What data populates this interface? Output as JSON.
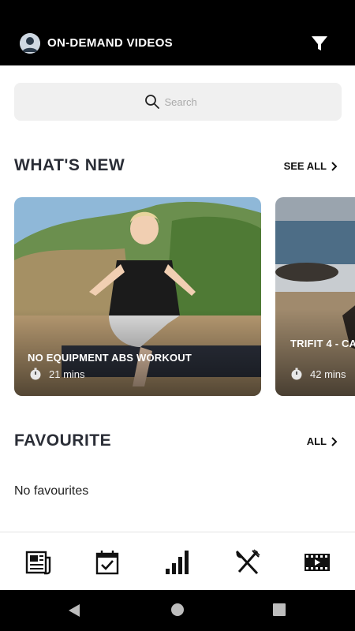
{
  "header": {
    "title": "ON-DEMAND VIDEOS",
    "avatar_icon": "user-avatar-icon",
    "filter_icon": "filter-icon"
  },
  "search": {
    "placeholder": "Search",
    "value": ""
  },
  "whats_new": {
    "title": "WHAT'S NEW",
    "link_label": "SEE ALL",
    "cards": [
      {
        "title": "NO EQUIPMENT ABS WORKOUT",
        "duration": "21 mins"
      },
      {
        "title": "TRIFIT 4 - CA",
        "duration": "42 mins"
      }
    ]
  },
  "favourite": {
    "title": "FAVOURITE",
    "link_label": "ALL",
    "empty_message": "No favourites"
  },
  "bottom_nav": {
    "items": [
      {
        "icon": "news-icon"
      },
      {
        "icon": "calendar-check-icon"
      },
      {
        "icon": "bar-chart-icon"
      },
      {
        "icon": "fork-knife-icon"
      },
      {
        "icon": "video-film-icon"
      }
    ]
  },
  "system_nav": {
    "items": [
      "back-icon",
      "home-icon",
      "recents-icon"
    ]
  },
  "colors": {
    "header_bg": "#000000",
    "search_bg": "#f0f0f0",
    "title_text": "#2a2d36"
  }
}
